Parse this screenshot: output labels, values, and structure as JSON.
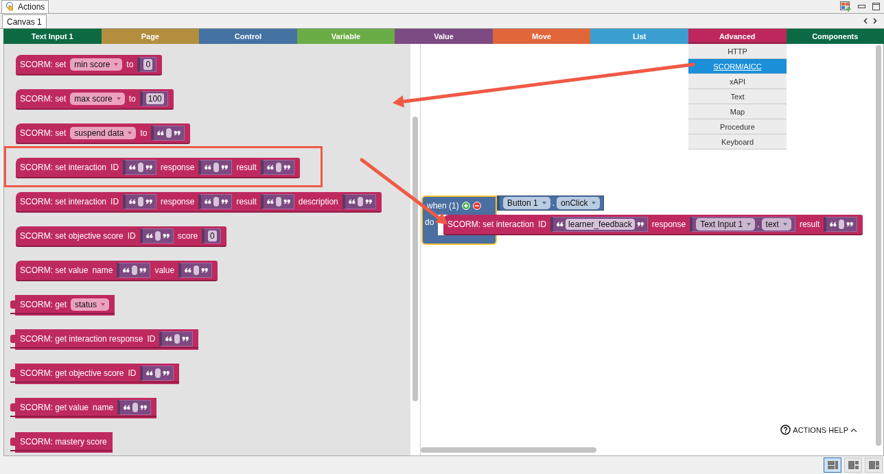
{
  "window": {
    "title": "Actions"
  },
  "canvas_tabs": [
    {
      "label": "Canvas 1",
      "selected": true
    }
  ],
  "categories": [
    {
      "label": "Text Input 1",
      "color": "#0c6a43",
      "selected": false
    },
    {
      "label": "Page",
      "color": "#b38f3d",
      "selected": false
    },
    {
      "label": "Control",
      "color": "#4472a2",
      "selected": false
    },
    {
      "label": "Variable",
      "color": "#6aad46",
      "selected": false
    },
    {
      "label": "Value",
      "color": "#7c4b83",
      "selected": false
    },
    {
      "label": "Move",
      "color": "#e0663a",
      "selected": false
    },
    {
      "label": "List",
      "color": "#3a9fd0",
      "selected": false
    },
    {
      "label": "Advanced",
      "color": "#bd275b",
      "selected": true
    },
    {
      "label": "Components",
      "color": "#0b6a44",
      "selected": false
    }
  ],
  "category_menu": [
    {
      "label": "HTTP",
      "selected": false
    },
    {
      "label": "SCORM/AICC",
      "selected": true
    },
    {
      "label": "xAPI",
      "selected": false
    },
    {
      "label": "Text",
      "selected": false
    },
    {
      "label": "Map",
      "selected": false
    },
    {
      "label": "Procedure",
      "selected": false
    },
    {
      "label": "Keyboard",
      "selected": false
    }
  ],
  "palette": {
    "blocks": [
      {
        "kind": "statement",
        "highlighted": false,
        "parts": [
          {
            "kind": "label",
            "text": "SCORM: set"
          },
          {
            "kind": "dropdown",
            "text": "min score"
          },
          {
            "kind": "label",
            "text": "to"
          },
          {
            "kind": "number",
            "text": "0"
          }
        ]
      },
      {
        "kind": "statement",
        "highlighted": false,
        "parts": [
          {
            "kind": "label",
            "text": "SCORM: set"
          },
          {
            "kind": "dropdown",
            "text": "max score"
          },
          {
            "kind": "label",
            "text": "to"
          },
          {
            "kind": "number",
            "text": "100"
          }
        ]
      },
      {
        "kind": "statement",
        "highlighted": false,
        "parts": [
          {
            "kind": "label",
            "text": "SCORM: set"
          },
          {
            "kind": "dropdown",
            "text": "suspend data"
          },
          {
            "kind": "label",
            "text": "to"
          },
          {
            "kind": "string"
          }
        ]
      },
      {
        "kind": "statement",
        "highlighted": true,
        "parts": [
          {
            "kind": "label",
            "text": "SCORM: set interaction"
          },
          {
            "kind": "label",
            "text": "ID"
          },
          {
            "kind": "string"
          },
          {
            "kind": "label",
            "text": "response"
          },
          {
            "kind": "string"
          },
          {
            "kind": "label",
            "text": "result"
          },
          {
            "kind": "string"
          }
        ]
      },
      {
        "kind": "statement",
        "highlighted": false,
        "parts": [
          {
            "kind": "label",
            "text": "SCORM: set interaction"
          },
          {
            "kind": "label",
            "text": "ID"
          },
          {
            "kind": "string"
          },
          {
            "kind": "label",
            "text": "response"
          },
          {
            "kind": "string"
          },
          {
            "kind": "label",
            "text": "result"
          },
          {
            "kind": "string"
          },
          {
            "kind": "label",
            "text": "description"
          },
          {
            "kind": "string"
          }
        ]
      },
      {
        "kind": "statement",
        "highlighted": false,
        "parts": [
          {
            "kind": "label",
            "text": "SCORM: set objective score"
          },
          {
            "kind": "label",
            "text": "ID"
          },
          {
            "kind": "string"
          },
          {
            "kind": "label",
            "text": "score"
          },
          {
            "kind": "number",
            "text": "0"
          }
        ]
      },
      {
        "kind": "statement",
        "highlighted": false,
        "parts": [
          {
            "kind": "label",
            "text": "SCORM: set value"
          },
          {
            "kind": "label",
            "text": "name"
          },
          {
            "kind": "string"
          },
          {
            "kind": "label",
            "text": "value"
          },
          {
            "kind": "string"
          }
        ]
      },
      {
        "kind": "value",
        "highlighted": false,
        "parts": [
          {
            "kind": "label",
            "text": "SCORM: get"
          },
          {
            "kind": "dropdown",
            "text": "status"
          }
        ]
      },
      {
        "kind": "value",
        "highlighted": false,
        "parts": [
          {
            "kind": "label",
            "text": "SCORM: get interaction response"
          },
          {
            "kind": "label",
            "text": "ID"
          },
          {
            "kind": "string"
          }
        ]
      },
      {
        "kind": "value",
        "highlighted": false,
        "parts": [
          {
            "kind": "label",
            "text": "SCORM: get objective score"
          },
          {
            "kind": "label",
            "text": "ID"
          },
          {
            "kind": "string"
          }
        ]
      },
      {
        "kind": "value",
        "highlighted": false,
        "parts": [
          {
            "kind": "label",
            "text": "SCORM: get value"
          },
          {
            "kind": "label",
            "text": "name"
          },
          {
            "kind": "string"
          }
        ]
      },
      {
        "kind": "value",
        "highlighted": false,
        "parts": [
          {
            "kind": "label",
            "text": "SCORM: mastery score"
          }
        ]
      }
    ]
  },
  "workspace": {
    "event": {
      "label": "when (1)",
      "selected": true,
      "object": "Button 1",
      "separator": ".",
      "event": "onClick",
      "do_label": "do",
      "body": {
        "parts": [
          {
            "kind": "label",
            "text": "SCORM: set interaction"
          },
          {
            "kind": "label",
            "text": "ID"
          },
          {
            "kind": "string",
            "text": "learner_feedback"
          },
          {
            "kind": "label",
            "text": "response"
          },
          {
            "kind": "getter",
            "object": "Text Input 1",
            "separator": ".",
            "property": "text"
          },
          {
            "kind": "label",
            "text": "result"
          },
          {
            "kind": "string"
          }
        ]
      }
    }
  },
  "help": {
    "label": "ACTIONS HELP"
  },
  "layout_buttons": [
    {
      "selected": true
    },
    {
      "selected": false
    },
    {
      "selected": false
    }
  ]
}
